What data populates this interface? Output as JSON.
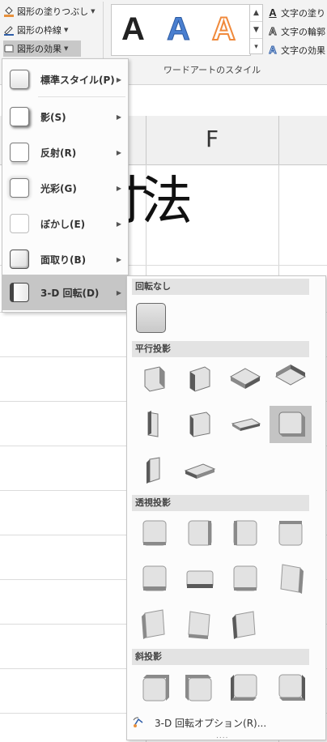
{
  "ribbon": {
    "shape_fill_label": "図形の塗りつぶし",
    "shape_outline_label": "図形の枠線",
    "shape_effects_label": "図形の効果",
    "wordart_letters": [
      "A",
      "A",
      "A"
    ],
    "wordart_colors": [
      "#111111",
      "#4a7fd0",
      "#f08a3c"
    ],
    "text_fill_label": "文字の塗り",
    "text_outline_label": "文字の輪郭",
    "text_effects_label": "文字の効果",
    "group_label": "ワードアートのスタイル"
  },
  "sheet": {
    "column_letter": "F",
    "cell_text": "法",
    "partial_left_char": "寸"
  },
  "effects_menu": {
    "items": [
      {
        "label": "標準スタイル(P)",
        "icon": "preset-thumb"
      },
      {
        "label": "影(S)",
        "icon": "shadow-thumb"
      },
      {
        "label": "反射(R)",
        "icon": "reflection-thumb"
      },
      {
        "label": "光彩(G)",
        "icon": "glow-thumb"
      },
      {
        "label": "ぼかし(E)",
        "icon": "soft-edges-thumb"
      },
      {
        "label": "面取り(B)",
        "icon": "bevel-thumb"
      },
      {
        "label": "3-D 回転(D)",
        "icon": "3d-rotation-thumb"
      }
    ],
    "selected": "3-D 回転(D)"
  },
  "rotation_menu": {
    "sections": {
      "none": "回転なし",
      "parallel": "平行投影",
      "perspective": "透視投影",
      "oblique": "斜投影"
    },
    "options_label": "3-D 回転オプション(R)...",
    "grip": "....",
    "selected_tile": "parallel-8"
  }
}
